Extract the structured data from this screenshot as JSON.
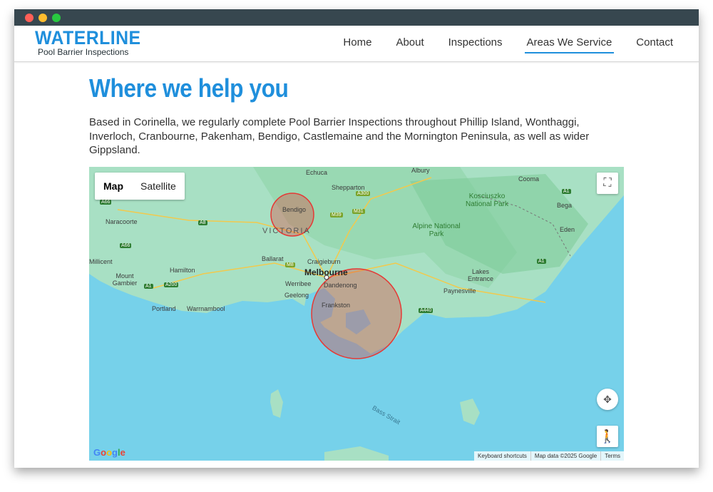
{
  "site": {
    "logo_main": "WATERLINE",
    "logo_sub": "Pool Barrier Inspections"
  },
  "nav": {
    "items": [
      {
        "label": "Home"
      },
      {
        "label": "About"
      },
      {
        "label": "Inspections"
      },
      {
        "label": "Areas We Service",
        "active": true
      },
      {
        "label": "Contact"
      }
    ]
  },
  "main": {
    "title": "Where we help you",
    "intro": "Based in Corinella, we regularly complete Pool Barrier Inspections throughout Phillip Island, Wonthaggi, Inverloch, Cranbourne, Pakenham, Bendigo, Castlemaine and the Mornington Peninsula, as well as wider Gippsland."
  },
  "map": {
    "type_controls": {
      "map": "Map",
      "satellite": "Satellite",
      "selected": "Map"
    },
    "labels": {
      "victoria": "VICTORIA",
      "melbourne": "Melbourne",
      "bendigo": "Bendigo",
      "frankston": "Frankston",
      "dandenong": "Dandenong",
      "echuca": "Echuca",
      "shepparton": "Shepparton",
      "albury": "Albury",
      "cooma": "Cooma",
      "bega": "Bega",
      "eden": "Eden",
      "naracoorte": "Naracoorte",
      "millicent": "Millicent",
      "mount_gambier": "Mount Gambier",
      "hamilton": "Hamilton",
      "ballarat": "Ballarat",
      "craigieburn": "Craigieburn",
      "werribee": "Werribee",
      "geelong": "Geelong",
      "portland": "Portland",
      "warrnambool": "Warrnambool",
      "lakes_entrance": "Lakes Entrance",
      "paynesville": "Paynesville",
      "kosciuszko": "Kosciuszko National Park",
      "alpine": "Alpine National Park",
      "bass_strait": "Bass Strait"
    },
    "roads": [
      "A66",
      "A8",
      "A66",
      "A1",
      "A200",
      "M39",
      "M31",
      "A300",
      "M8",
      "A440",
      "A1",
      "A1"
    ],
    "attribution": {
      "shortcuts": "Keyboard shortcuts",
      "data": "Map data ©2025 Google",
      "terms": "Terms"
    },
    "logo": "Google",
    "service_areas": [
      {
        "name": "Bendigo",
        "radius": "small"
      },
      {
        "name": "Frankston / Mornington Peninsula / Gippsland",
        "radius": "large"
      }
    ],
    "colors": {
      "sea": "#76d1ea",
      "land": "#a8e0c4",
      "circle": "#e53935"
    }
  },
  "colors": {
    "accent": "#1f8fdc",
    "chrome": "#37474f"
  }
}
